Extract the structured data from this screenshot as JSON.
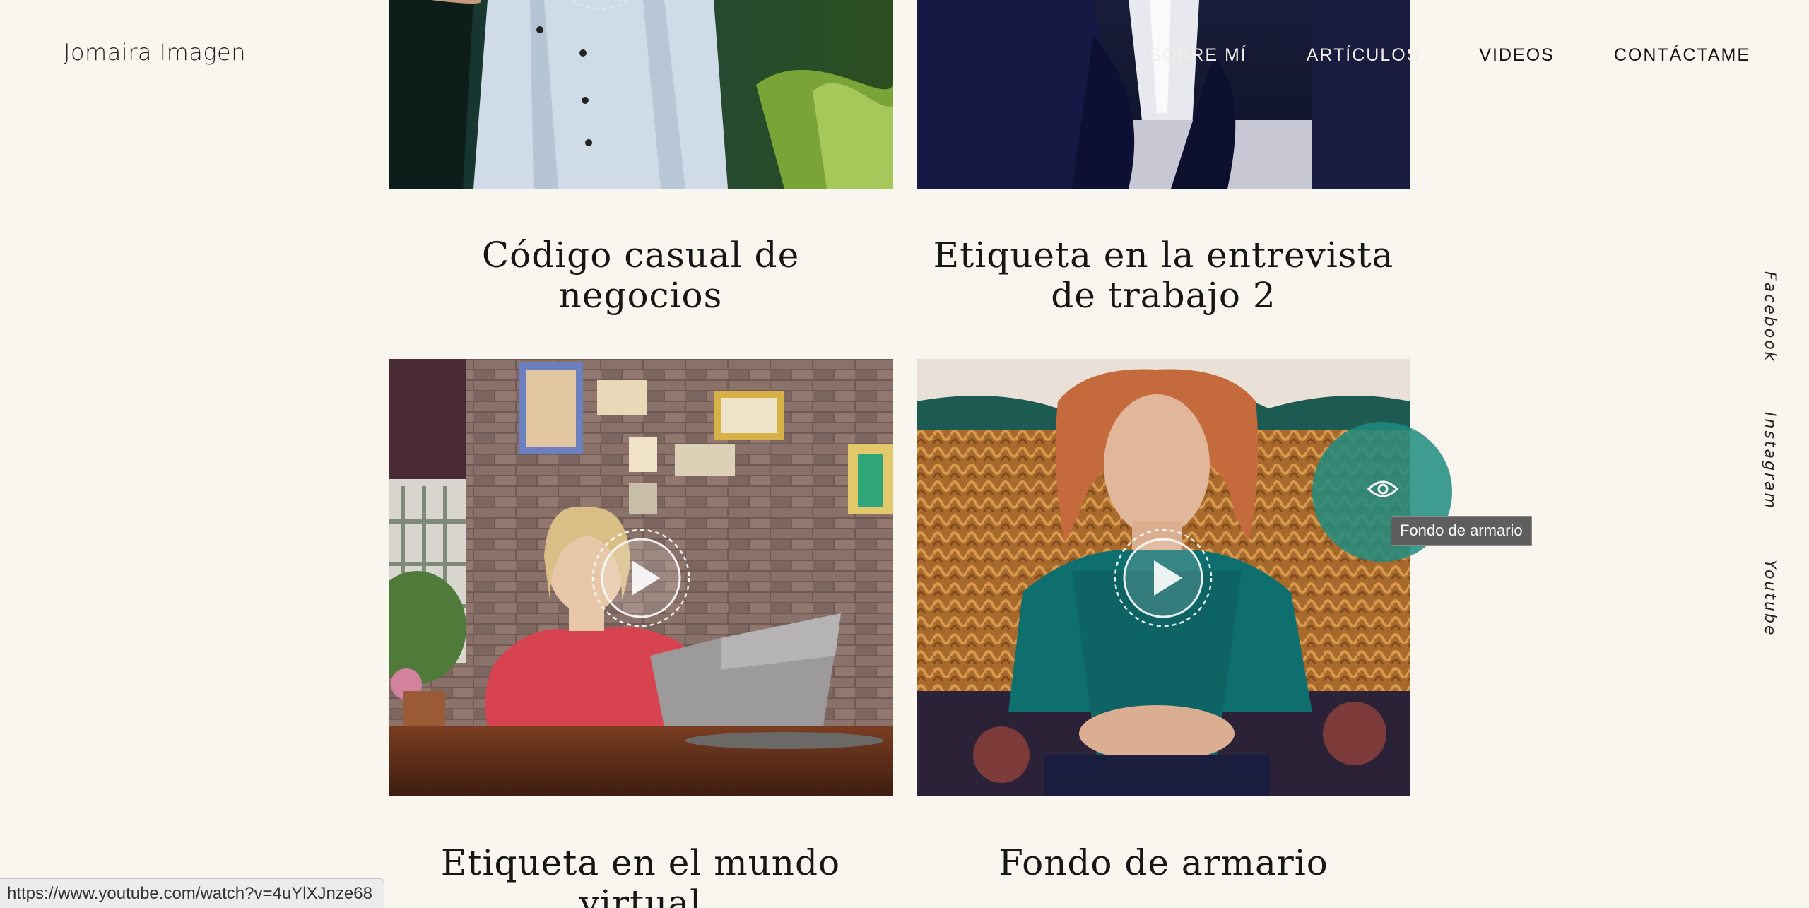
{
  "site": {
    "title": "Jomaira Imagen"
  },
  "nav": {
    "items": [
      {
        "label": "SOBRE MÍ"
      },
      {
        "label": "ARTÍCULOS"
      },
      {
        "label": "VIDEOS"
      },
      {
        "label": "CONTÁCTAME"
      }
    ]
  },
  "social": {
    "facebook": "Facebook",
    "instagram": "Instagram",
    "youtube": "Youtube"
  },
  "cards": [
    {
      "title_line1": "Código casual de",
      "title_line2": "negocios"
    },
    {
      "title_line1": "Etiqueta en la entrevista",
      "title_line2": "de trabajo 2"
    },
    {
      "title_line1": "Etiqueta en el mundo",
      "title_line2": "virtual"
    },
    {
      "title_line1": "Fondo de armario",
      "title_line2": ""
    }
  ],
  "tooltip": {
    "text": "Fondo de armario"
  },
  "status_bar": {
    "url": "https://www.youtube.com/watch?v=4uYlXJnze68"
  },
  "colors": {
    "background": "#f9f5ef",
    "accent_teal": "#1e8c80"
  }
}
